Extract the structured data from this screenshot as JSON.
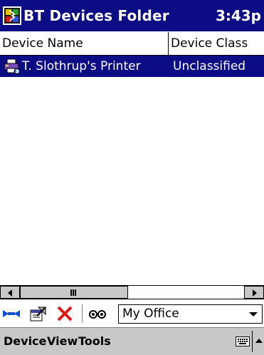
{
  "titlebar": {
    "title": "BT Devices Folder",
    "clock": "3:43p",
    "app_icon": "bluetooth-folder-icon"
  },
  "columns": [
    {
      "label": "Device Name"
    },
    {
      "label": "Device Class"
    }
  ],
  "devices": [
    {
      "name": "T. Slothrup's Printer",
      "device_class": "Unclassified",
      "selected": true,
      "icon": "printer-device-icon"
    }
  ],
  "toolbar": {
    "icons": [
      "connect-icon",
      "properties-icon",
      "delete-icon",
      "discover-icon"
    ],
    "location_value": "My Office"
  },
  "menubar": {
    "items": [
      "Device",
      "View",
      "Tools"
    ]
  },
  "colors": {
    "titlebar": "#0c0c84",
    "selection": "#0c0c84",
    "menubar": "#c8c8c8"
  }
}
